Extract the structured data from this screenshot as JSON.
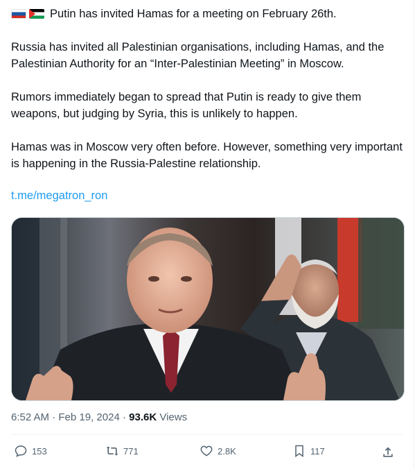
{
  "tweet": {
    "flags": [
      "russia-flag-icon",
      "palestine-flag-icon"
    ],
    "line1": "Putin has invited Hamas for a meeting on February 26th.",
    "para2": "Russia has invited all Palestinian organisations, including Hamas, and the Palestinian Authority for an “Inter-Palestinian Meeting” in Moscow.",
    "para3": "Rumors immediately began to spread that Putin is ready to give them weapons, but judging by Syria, this is unlikely to happen.",
    "para4": "Hamas was in Moscow very often before. However, something very important is happening in the Russia-Palestine relationship.",
    "link": "t.me/megatron_ron"
  },
  "meta": {
    "time": "6:52 AM",
    "sep": " · ",
    "date": "Feb 19, 2024",
    "views_count": "93.6K",
    "views_label": " Views"
  },
  "actions": {
    "replies": "153",
    "reposts": "771",
    "likes": "2.8K",
    "bookmarks": "117"
  },
  "colors": {
    "link": "#1d9bf0",
    "muted": "#536471"
  }
}
